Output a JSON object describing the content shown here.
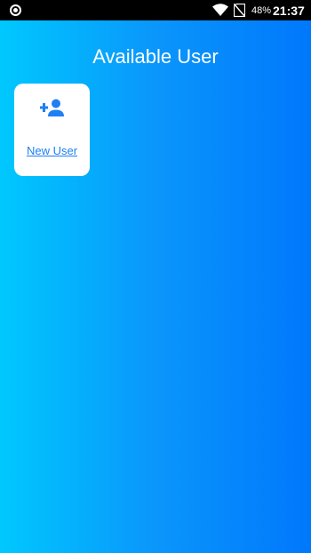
{
  "status_bar": {
    "battery": "48%",
    "time": "21:37",
    "icons": [
      "record-icon",
      "wifi-icon",
      "no-sim-icon"
    ]
  },
  "page": {
    "title": "Available User"
  },
  "users": [
    {
      "label": "New User",
      "icon": "add-user-icon"
    }
  ],
  "colors": {
    "gradient_start": "#00c8fe",
    "gradient_end": "#0078fc",
    "accent": "#1f7ff3",
    "card_background": "#ffffff"
  }
}
